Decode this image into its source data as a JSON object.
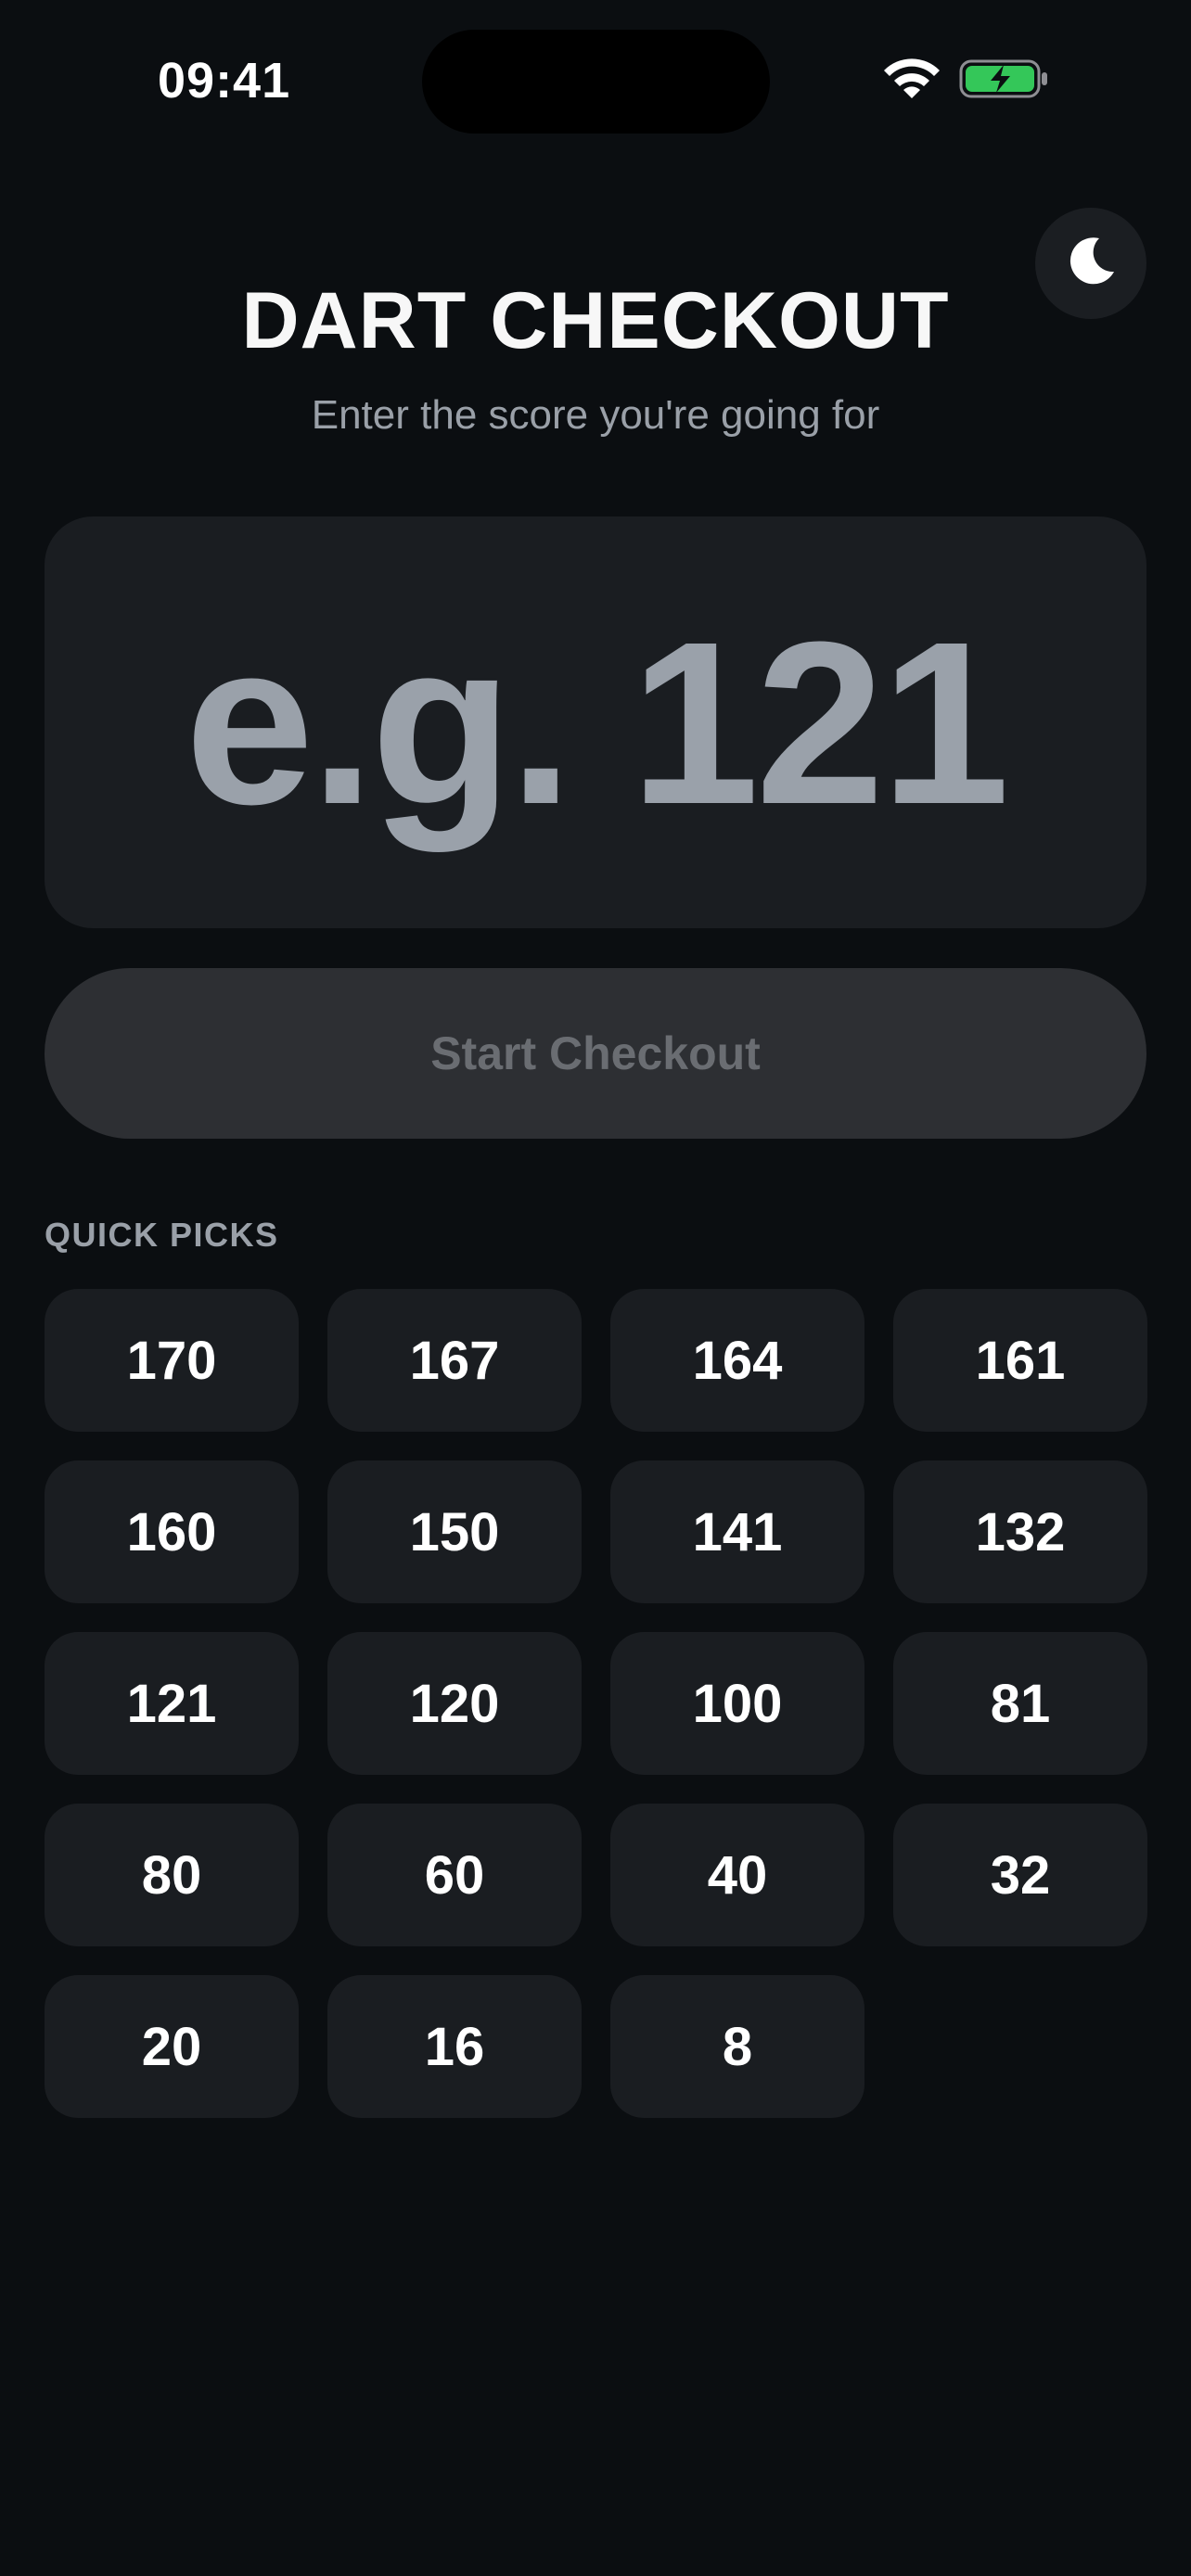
{
  "status_bar": {
    "time": "09:41",
    "wifi_icon": "wifi-icon",
    "battery_icon": "battery-charging-icon",
    "battery_color": "#34c759"
  },
  "theme_toggle": {
    "icon": "moon-icon"
  },
  "header": {
    "title": "DART CHECKOUT",
    "subtitle": "Enter the score you're going for"
  },
  "score_input": {
    "value": "",
    "placeholder": "e.g. 121"
  },
  "start_button": {
    "label": "Start Checkout",
    "enabled": false
  },
  "quick_picks": {
    "label": "QUICK PICKS",
    "items": [
      "170",
      "167",
      "164",
      "161",
      "160",
      "150",
      "141",
      "132",
      "121",
      "120",
      "100",
      "81",
      "80",
      "60",
      "40",
      "32",
      "20",
      "16",
      "8"
    ]
  },
  "colors": {
    "background": "#0b0e11",
    "card": "#1a1d21",
    "button_disabled": "#2d2f33",
    "muted_text": "#9aa0a8"
  }
}
